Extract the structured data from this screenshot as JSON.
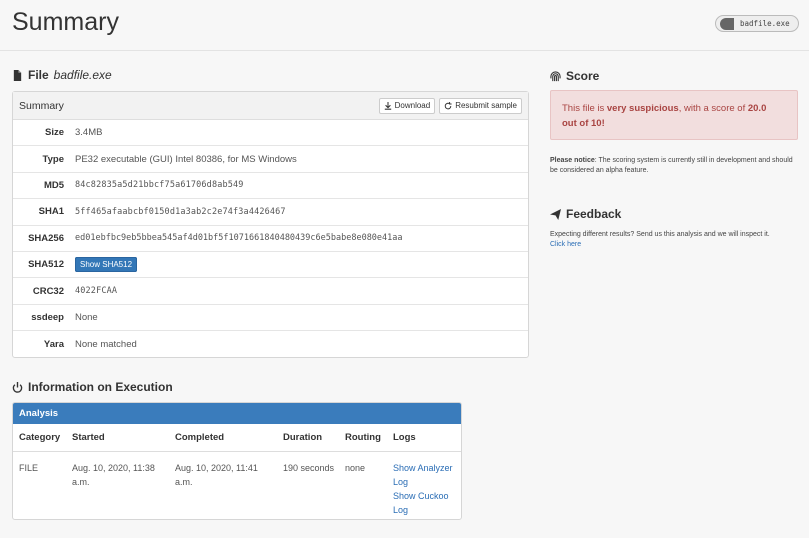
{
  "header": {
    "title": "Summary",
    "badge_label": "badfile.exe"
  },
  "file_section": {
    "heading_prefix": "File",
    "filename": "badfile.exe"
  },
  "summary_panel": {
    "title": "Summary",
    "download_label": "Download",
    "resubmit_label": "Resubmit sample",
    "rows": [
      {
        "key": "Size",
        "value": "3.4MB"
      },
      {
        "key": "Type",
        "value": "PE32 executable (GUI) Intel 80386, for MS Windows"
      },
      {
        "key": "MD5",
        "value": "84c82835a5d21bbcf75a61706d8ab549"
      },
      {
        "key": "SHA1",
        "value": "5ff465afaabcbf0150d1a3ab2c2e74f3a4426467"
      },
      {
        "key": "SHA256",
        "value": "ed01ebfbc9eb5bbea545af4d01bf5f1071661840480439c6e5babe8e080e41aa"
      },
      {
        "key": "SHA512",
        "value": "Show SHA512"
      },
      {
        "key": "CRC32",
        "value": "4022FCAA"
      },
      {
        "key": "ssdeep",
        "value": "None"
      },
      {
        "key": "Yara",
        "value": "None matched"
      }
    ]
  },
  "score": {
    "heading": "Score",
    "message_prefix": "This file is ",
    "message_bold": "very suspicious",
    "message_mid": ", with a score of ",
    "score_value": "20.0",
    "message_suffix": "out of 10!",
    "notice_label": "Please notice",
    "notice_text": ": The scoring system is currently still in development and should be considered an alpha feature."
  },
  "feedback": {
    "heading": "Feedback",
    "text": "Expecting different results? Send us this analysis and we will inspect it.",
    "link": "Click here"
  },
  "execution": {
    "heading": "Information on Execution",
    "panel_title": "Analysis",
    "columns": [
      "Category",
      "Started",
      "Completed",
      "Duration",
      "Routing",
      "Logs"
    ],
    "row": {
      "category": "FILE",
      "started": "Aug. 10, 2020, 11:38 a.m.",
      "completed": "Aug. 10, 2020, 11:41 a.m.",
      "duration": "190 seconds",
      "routing": "none",
      "log_analyzer": "Show Analyzer Log",
      "log_cuckoo": "Show Cuckoo Log"
    }
  }
}
